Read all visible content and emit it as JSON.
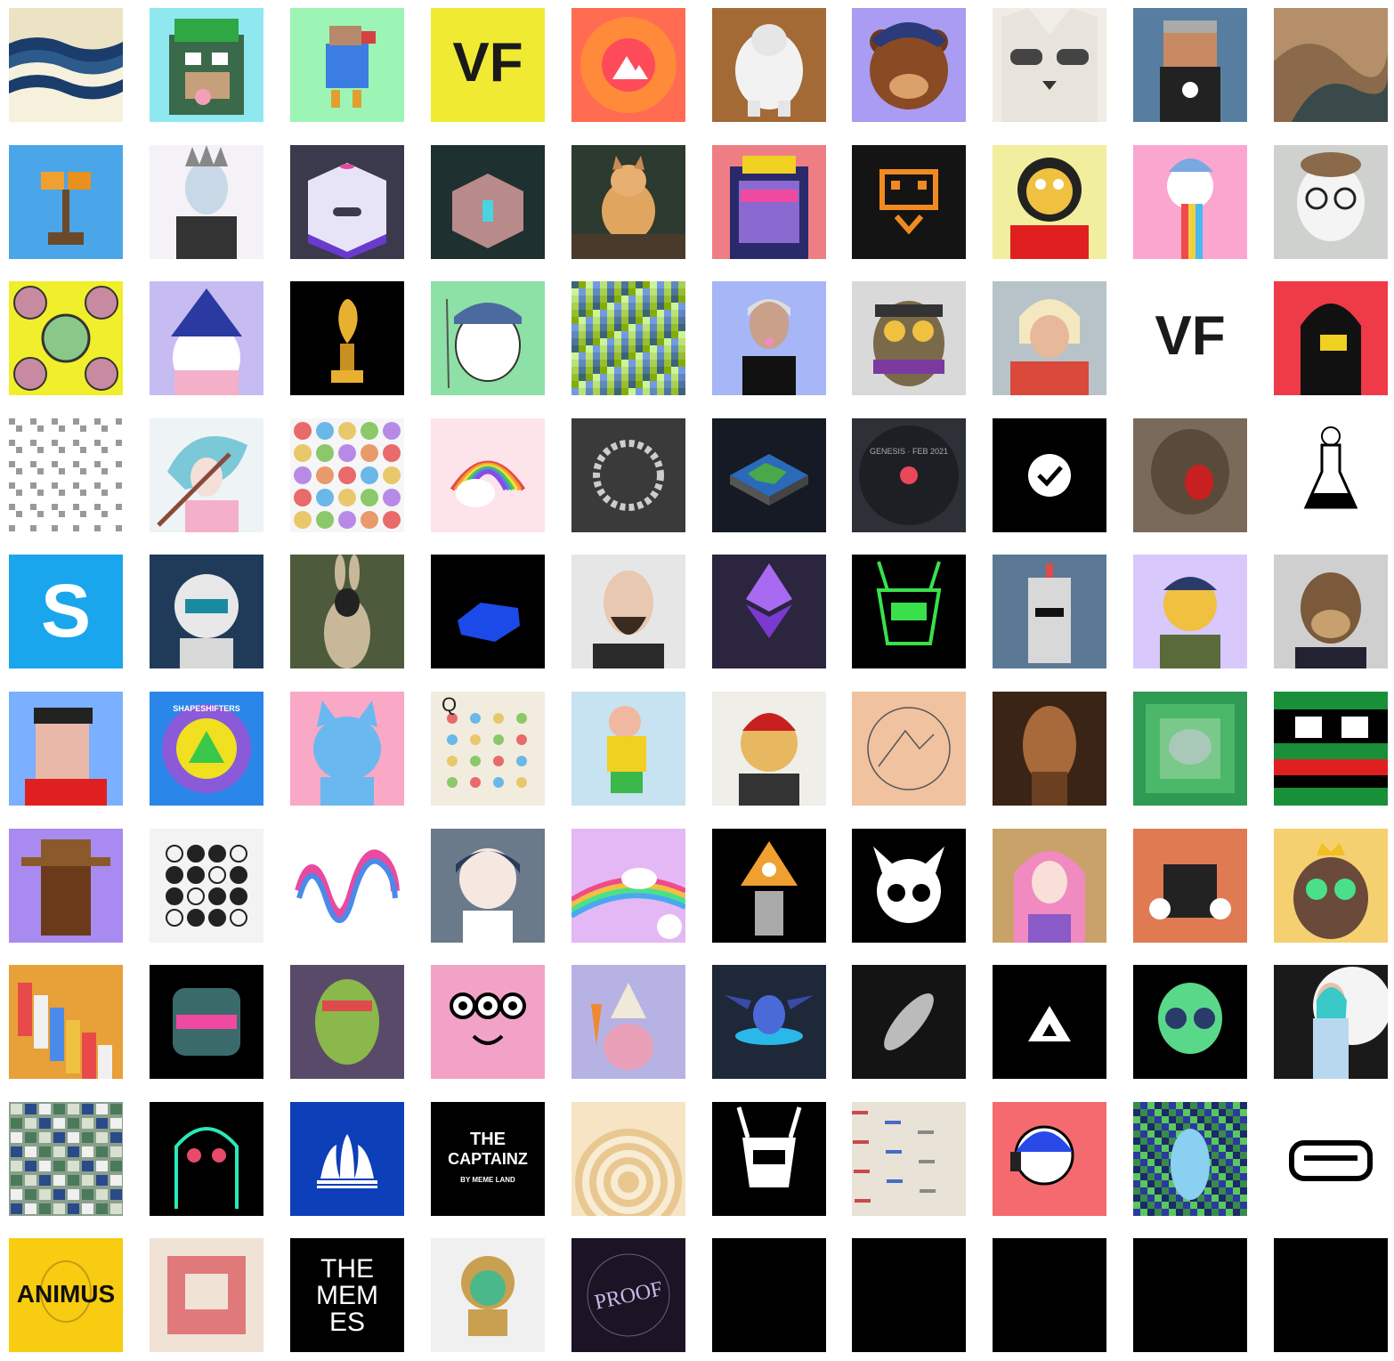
{
  "gallery": {
    "tiles": [
      {
        "bg": "#ece3c4",
        "icon": "waves"
      },
      {
        "bg": "#8fe8f0",
        "icon": "ape-beanie"
      },
      {
        "bg": "#9cf5b4",
        "icon": "pixel-bird"
      },
      {
        "bg": "#f0eb32",
        "icon": "vf-logo",
        "text": "VF"
      },
      {
        "bg": "#ff6c52",
        "icon": "decentraland-logo"
      },
      {
        "bg": "#a36a36",
        "icon": "white-gorilla"
      },
      {
        "bg": "#a99cf2",
        "icon": "bear"
      },
      {
        "bg": "#f27a3d",
        "icon": "raccoon"
      },
      {
        "bg": "#577ea0",
        "icon": "voxel-figure"
      },
      {
        "bg": "#b58f6a",
        "icon": "abstract-paint"
      },
      {
        "bg": "#4aa6e8",
        "icon": "pixel-plant"
      },
      {
        "bg": "#f4f2f7",
        "icon": "punk-portrait"
      },
      {
        "bg": "#3a3a4c",
        "icon": "cube-box"
      },
      {
        "bg": "#1f3030",
        "icon": "vault-chest"
      },
      {
        "bg": "#2d3a30",
        "icon": "doge-dog"
      },
      {
        "bg": "#ef7e84",
        "icon": "pixel-gorilla"
      },
      {
        "bg": "#141414",
        "icon": "orange-glyph"
      },
      {
        "bg": "#f1ee9e",
        "icon": "monkey-face"
      },
      {
        "bg": "#fba6cf",
        "icon": "rainbow-boy"
      },
      {
        "bg": "#cfd1cf",
        "icon": "spiral-eyes"
      },
      {
        "bg": "#f1ee2c",
        "icon": "flowers"
      },
      {
        "bg": "#c7bcf2",
        "icon": "penguin-wizard"
      },
      {
        "bg": "#000000",
        "icon": "gold-trophy"
      },
      {
        "bg": "#8de0a6",
        "icon": "fishing-cat"
      },
      {
        "bg": "#555555",
        "icon": "pixel-noise"
      },
      {
        "bg": "#a6b6f6",
        "icon": "woman-portrait"
      },
      {
        "bg": "#d9d9d9",
        "icon": "owl-ninja"
      },
      {
        "bg": "#b8c3c9",
        "icon": "anime-man"
      },
      {
        "bg": "#ffffff",
        "icon": "vf-logo",
        "text": "VF"
      },
      {
        "bg": "#ef3a48",
        "icon": "hooded-figure"
      },
      {
        "bg": "#ffffff",
        "icon": "qr-pattern"
      },
      {
        "bg": "#eef3f5",
        "icon": "anime-girl"
      },
      {
        "bg": "#f6f6f6",
        "icon": "dots"
      },
      {
        "bg": "#fde4ea",
        "icon": "rainbow-cloud"
      },
      {
        "bg": "#3a3a3a",
        "icon": "chain-ring"
      },
      {
        "bg": "#151a24",
        "icon": "island-map"
      },
      {
        "bg": "#2e3038",
        "icon": "genesis-record",
        "text": "GENESIS · FEB 2021"
      },
      {
        "bg": "#000000",
        "icon": "verified-badge"
      },
      {
        "bg": "#7a6a5a",
        "icon": "screaming-ape"
      },
      {
        "bg": "#ffffff",
        "icon": "lab-flask"
      },
      {
        "bg": "#1aa6ec",
        "icon": "sandbox-logo",
        "text": "S"
      },
      {
        "bg": "#203b5a",
        "icon": "robot-head"
      },
      {
        "bg": "#4e5a3c",
        "icon": "rabbit-figure"
      },
      {
        "bg": "#000000",
        "icon": "blue-hexagon"
      },
      {
        "bg": "#e6e6e6",
        "icon": "bald-man"
      },
      {
        "bg": "#2c2540",
        "icon": "ethereum-crystal"
      },
      {
        "bg": "#000000",
        "icon": "green-robot"
      },
      {
        "bg": "#5b7994",
        "icon": "pixel-robot"
      },
      {
        "bg": "#d8c8fb",
        "icon": "soldier-bear"
      },
      {
        "bg": "#cfcfcf",
        "icon": "bored-ape"
      },
      {
        "bg": "#7ab0ff",
        "icon": "cryptopunk"
      },
      {
        "bg": "#2a86e8",
        "icon": "shapeshifters-logo",
        "text": "SHAPESHIFTERS"
      },
      {
        "bg": "#f9a8c6",
        "icon": "blue-cat"
      },
      {
        "bg": "#f2ecdf",
        "icon": "letter-dots",
        "text": "Q"
      },
      {
        "bg": "#c7e2f0",
        "icon": "hiker-character"
      },
      {
        "bg": "#efeee8",
        "icon": "spartan-cat"
      },
      {
        "bg": "#f0c2a0",
        "icon": "circle-mountains"
      },
      {
        "bg": "#3a2416",
        "icon": "ghostly-figure"
      },
      {
        "bg": "#2f9a54",
        "icon": "green-squares"
      },
      {
        "bg": "#1a8f3a",
        "icon": "pepe-pixel"
      },
      {
        "bg": "#a88af0",
        "icon": "cowboy-punk"
      },
      {
        "bg": "#f3f3f3",
        "icon": "dot-grid"
      },
      {
        "bg": "#ffffff",
        "icon": "rainbow-wave"
      },
      {
        "bg": "#6b7a8a",
        "icon": "doll-girl"
      },
      {
        "bg": "#e4b8f4",
        "icon": "unicorn-sky"
      },
      {
        "bg": "#000000",
        "icon": "pyramid-wizard"
      },
      {
        "bg": "#000000",
        "icon": "horned-skull"
      },
      {
        "bg": "#c9a26a",
        "icon": "pink-hair-girl"
      },
      {
        "bg": "#e07a52",
        "icon": "box-hands"
      },
      {
        "bg": "#f5d070",
        "icon": "king-owl"
      },
      {
        "bg": "#e8a038",
        "icon": "isometric-city"
      },
      {
        "bg": "#000000",
        "icon": "neon-robot"
      },
      {
        "bg": "#5a4a6a",
        "icon": "zombie-ape"
      },
      {
        "bg": "#f2a2c6",
        "icon": "three-eyes"
      },
      {
        "bg": "#b7b2e4",
        "icon": "gnome-carrot"
      },
      {
        "bg": "#1e2838",
        "icon": "blue-dragon"
      },
      {
        "bg": "#141414",
        "icon": "xray-shape"
      },
      {
        "bg": "#000000",
        "icon": "triangle-logo"
      },
      {
        "bg": "#000000",
        "icon": "green-skull"
      },
      {
        "bg": "#1a1a1a",
        "icon": "avatar-woman"
      },
      {
        "bg": "#8aa08c",
        "icon": "aerial-map"
      },
      {
        "bg": "#000000",
        "icon": "skull-drawing"
      },
      {
        "bg": "#0d3fb8",
        "icon": "adidas-logo"
      },
      {
        "bg": "#000000",
        "icon": "captainz-logo",
        "text": "THE CAPTAINZ",
        "subtext": "BY MEME LAND"
      },
      {
        "bg": "#f6e4c4",
        "icon": "concentric-circles"
      },
      {
        "bg": "#000000",
        "icon": "mech-sketch"
      },
      {
        "bg": "#e9e2d6",
        "icon": "glitch-paper"
      },
      {
        "bg": "#f56a6e",
        "icon": "headphone-guy"
      },
      {
        "bg": "#2a3a80",
        "icon": "pixel-penguin"
      },
      {
        "bg": "#ffffff",
        "icon": "pixel-face"
      },
      {
        "bg": "#f8cc10",
        "icon": "animus-logo",
        "text": "ANIMUS"
      },
      {
        "bg": "#f1e2d6",
        "icon": "red-square-art"
      },
      {
        "bg": "#000000",
        "icon": "memes-logo",
        "text": "THE MEMES"
      },
      {
        "bg": "#f0f0f0",
        "icon": "diver-character"
      },
      {
        "bg": "#1c1424",
        "icon": "proof-logo",
        "text": "PROOF"
      },
      {
        "bg": "#000000",
        "icon": "empty-slot"
      },
      {
        "bg": "#000000",
        "icon": "empty-slot"
      },
      {
        "bg": "#000000",
        "icon": "empty-slot"
      },
      {
        "bg": "#000000",
        "icon": "empty-slot"
      },
      {
        "bg": "#000000",
        "icon": "empty-slot"
      }
    ]
  }
}
